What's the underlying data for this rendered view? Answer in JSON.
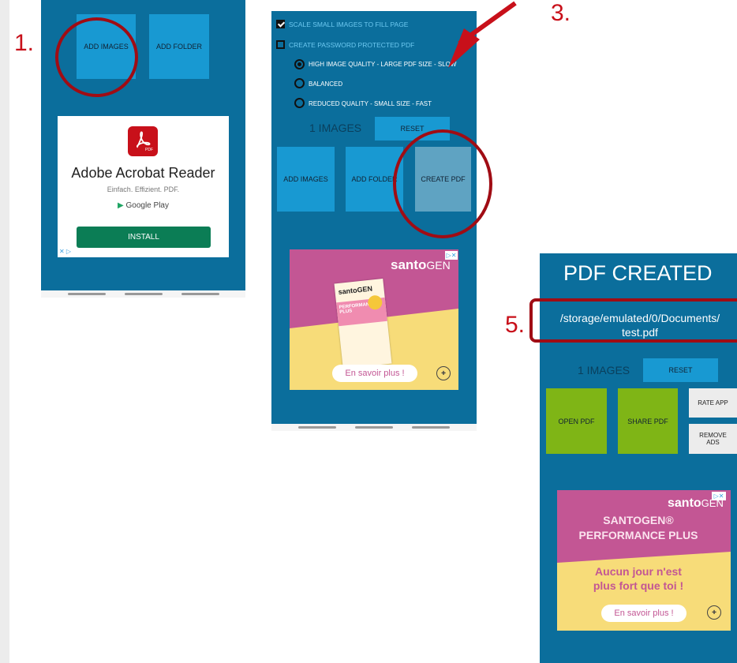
{
  "steps": {
    "step1": "1.",
    "step3": "3.",
    "step5": "5."
  },
  "screen1": {
    "buttons": {
      "add_images": "ADD IMAGES",
      "add_folder": "ADD FOLDER"
    },
    "ad": {
      "icon_label": "PDF",
      "title": "Adobe Acrobat Reader",
      "subtitle": "Einfach. Effizient. PDF.",
      "store": "Google Play",
      "install": "INSTALL",
      "ad_close": "✕ ▷"
    }
  },
  "screen2": {
    "options": {
      "scale": "SCALE SMALL IMAGES TO FILL PAGE",
      "password": "CREATE PASSWORD PROTECTED PDF",
      "quality_high": "HIGH IMAGE QUALITY - LARGE PDF SIZE - SLOW",
      "quality_balanced": "BALANCED",
      "quality_reduced": "REDUCED QUALITY - SMALL SIZE - FAST"
    },
    "images_count": "1 IMAGES",
    "reset": "RESET",
    "buttons": {
      "add_images": "ADD IMAGES",
      "add_folder": "ADD FOLDER",
      "create_pdf": "CREATE PDF"
    },
    "ad": {
      "brand": "santo",
      "brand_suffix": "GEN",
      "product": "santoGEN",
      "product_line": "PERFORMANCE PLUS",
      "cta": "En savoir plus !"
    }
  },
  "screen3": {
    "title": "PDF CREATED",
    "path": "/storage/emulated/0/Documents/ test.pdf",
    "images_count": "1 IMAGES",
    "reset": "RESET",
    "buttons": {
      "open_pdf": "OPEN PDF",
      "share_pdf": "SHARE PDF",
      "rate_app": "RATE APP",
      "remove_ads": "REMOVE ADS"
    },
    "ad": {
      "brand": "santo",
      "brand_suffix": "GEN",
      "headline_1": "SANTOGEN®",
      "headline_2": "PERFORMANCE PLUS",
      "tagline_1": "Aucun jour n'est",
      "tagline_2": "plus fort que toi !",
      "cta": "En savoir plus !"
    }
  },
  "colors": {
    "screen_bg": "#0b6e9c",
    "button_blue": "#1899d2",
    "annotation_red": "#a00c14",
    "green": "#7fb516"
  }
}
